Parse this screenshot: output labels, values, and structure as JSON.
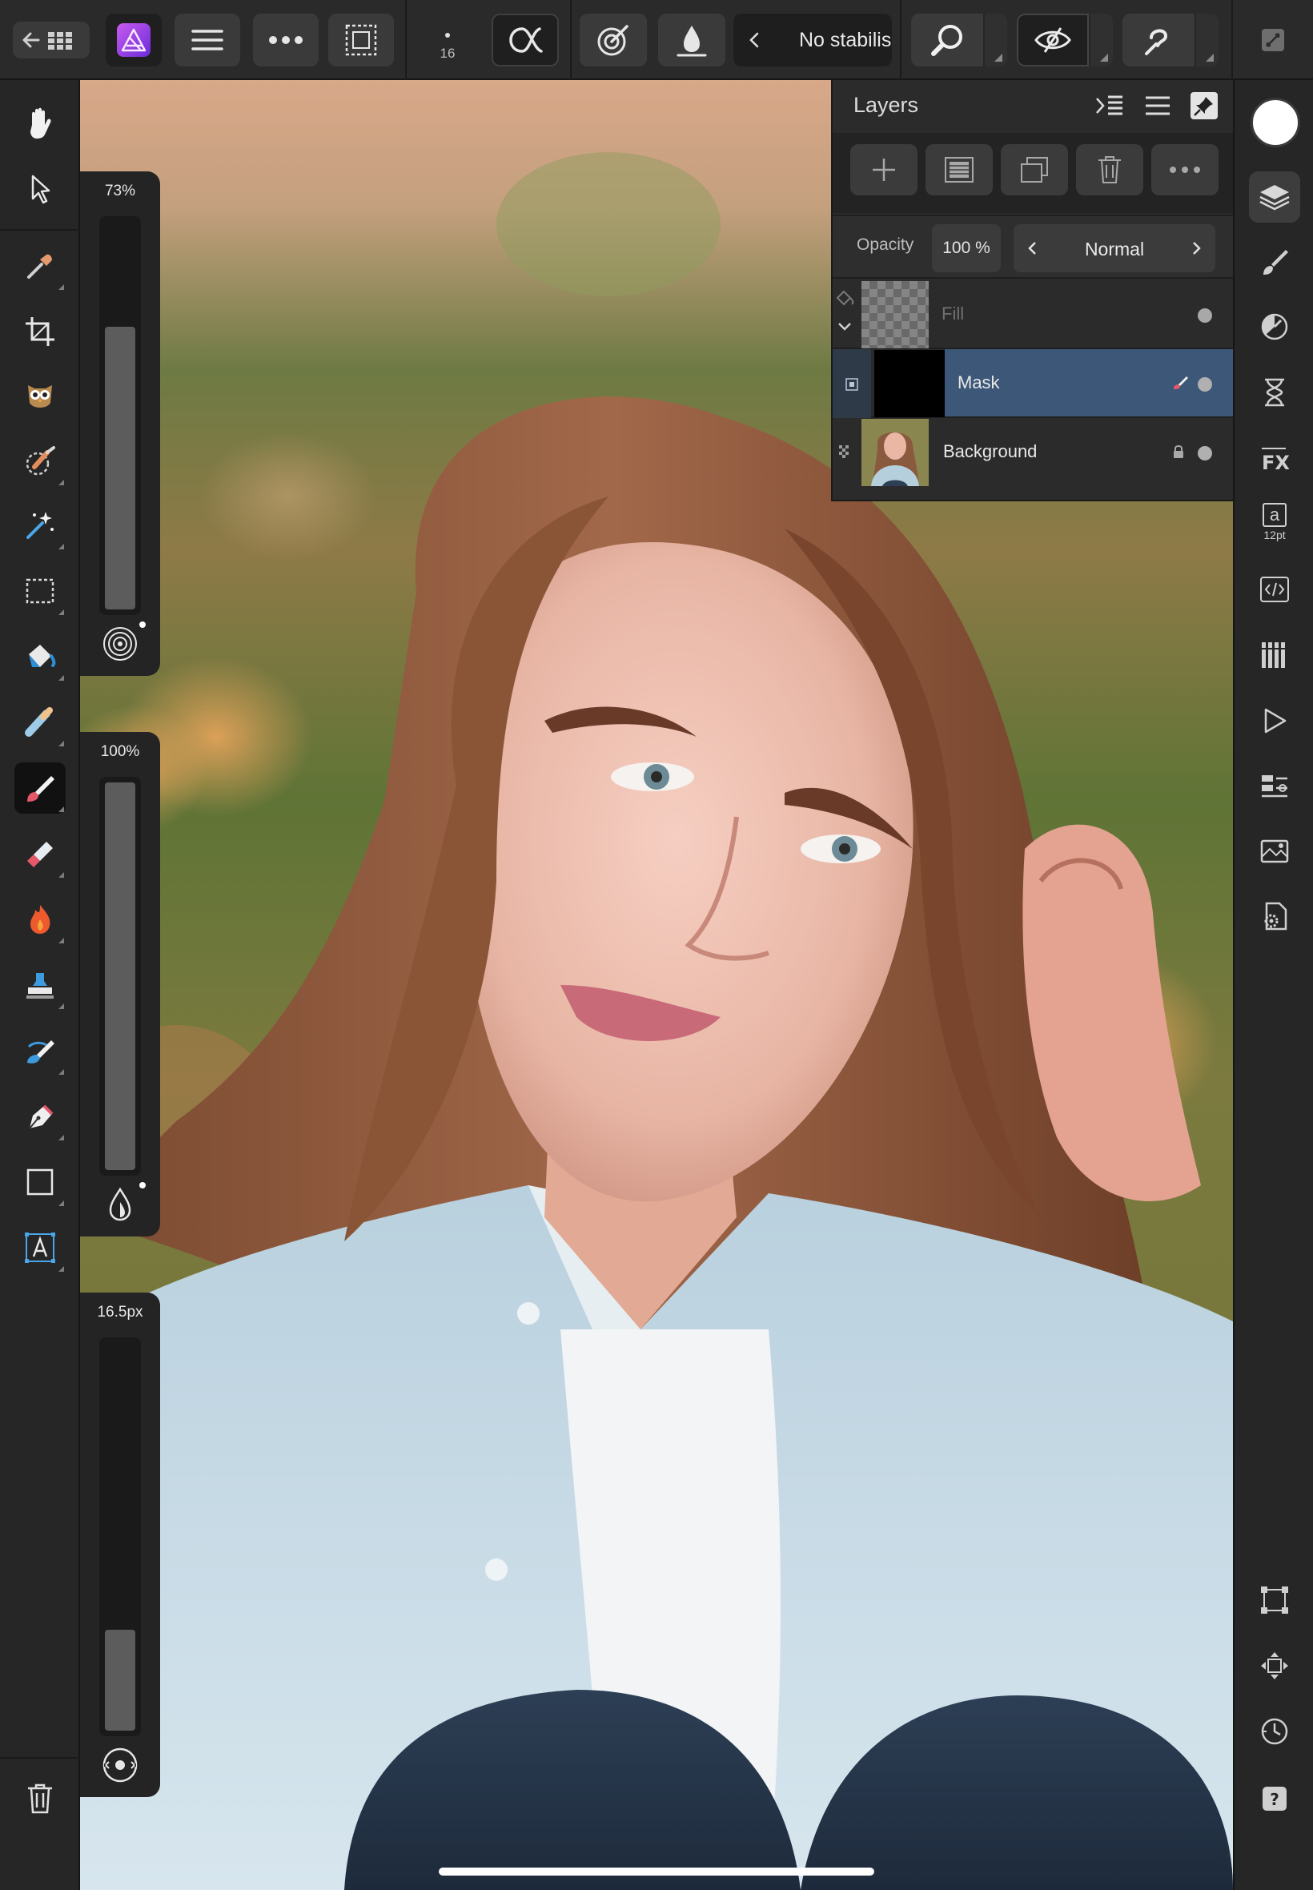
{
  "toolbar": {
    "brush_size_value": "16",
    "stabiliser_label": "No stabilis"
  },
  "sliders": {
    "flow_value": "73%",
    "flow_fraction": 0.73,
    "opacity_value": "100%",
    "opacity_fraction": 1.0,
    "width_value": "16.5px",
    "width_fraction": 0.26
  },
  "layers_panel": {
    "title": "Layers",
    "opacity_label": "Opacity",
    "opacity_value": "100 %",
    "blend_mode": "Normal",
    "layers": [
      {
        "name": "Fill"
      },
      {
        "name": "Mask"
      },
      {
        "name": "Background"
      }
    ]
  },
  "studio": {
    "text_style_size": "12pt",
    "text_style_glyph": "a"
  },
  "colors": {
    "accent_selection": "#3c5777",
    "panel_background": "#2b2b2b",
    "toolbar_background": "#2a2a2a",
    "primary_color": "#ffffff"
  }
}
